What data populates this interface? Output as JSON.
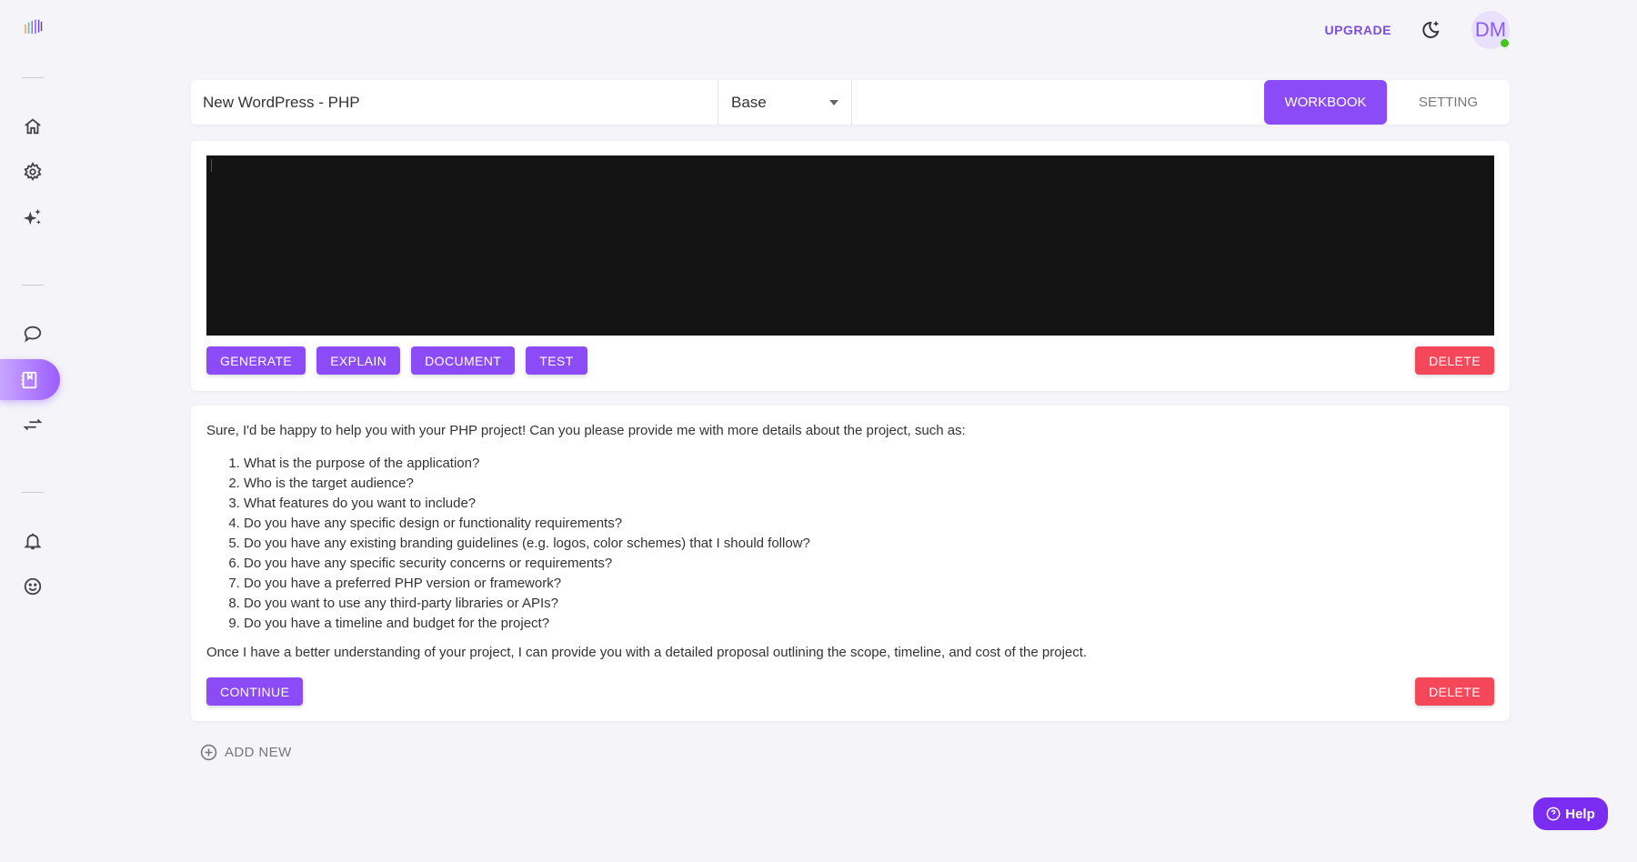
{
  "header": {
    "upgrade": "UPGRADE",
    "avatar_initials": "DM",
    "status_color": "#44c21e"
  },
  "toolbar": {
    "title": "New WordPress - PHP",
    "model": "Base",
    "workbook": "WORKBOOK",
    "setting": "SETTING"
  },
  "code_card": {
    "buttons": [
      "GENERATE",
      "EXPLAIN",
      "DOCUMENT",
      "TEST"
    ],
    "delete": "DELETE"
  },
  "response": {
    "intro": "Sure, I'd be happy to help you with your PHP project! Can you please provide me with more details about the project, such as:",
    "items": [
      "What is the purpose of the application?",
      "Who is the target audience?",
      "What features do you want to include?",
      "Do you have any specific design or functionality requirements?",
      "Do you have any existing branding guidelines (e.g. logos, color schemes) that I should follow?",
      "Do you have any specific security concerns or requirements?",
      "Do you have a preferred PHP version or framework?",
      "Do you want to use any third-party libraries or APIs?",
      "Do you have a timeline and budget for the project?"
    ],
    "outro": "Once I have a better understanding of your project, I can provide you with a detailed proposal outlining the scope, timeline, and cost of the project.",
    "continue": "CONTINUE",
    "delete": "DELETE"
  },
  "add_new": "ADD NEW",
  "help": "Help",
  "colors": {
    "accent": "#8b4cf7",
    "danger": "#f4485a"
  }
}
